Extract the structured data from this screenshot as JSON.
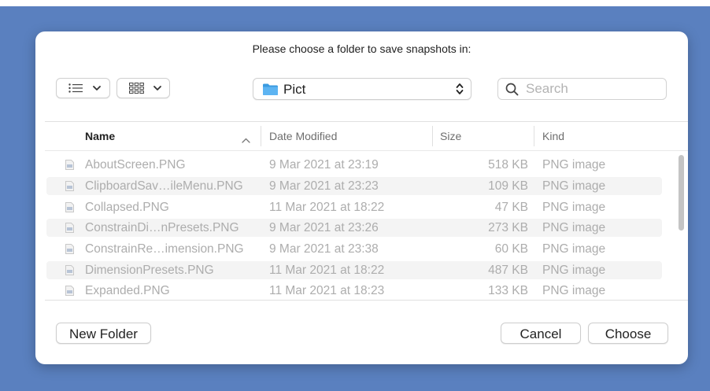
{
  "dialog": {
    "prompt": "Please choose a folder to save snapshots in:"
  },
  "toolbar": {
    "list_view_icon": "list-view-icon",
    "grid_view_icon": "grid-view-icon",
    "folder": {
      "icon": "folder-icon",
      "name": "Pict"
    },
    "search": {
      "placeholder": "Search",
      "value": ""
    }
  },
  "table": {
    "columns": [
      "Name",
      "Date Modified",
      "Size",
      "Kind"
    ],
    "sorted_by": "Name",
    "rows": [
      {
        "name": "AboutScreen.PNG",
        "date": "9 Mar 2021 at 23:19",
        "size": "518 KB",
        "kind": "PNG image"
      },
      {
        "name": "ClipboardSav…ileMenu.PNG",
        "date": "9 Mar 2021 at 23:23",
        "size": "109 KB",
        "kind": "PNG image"
      },
      {
        "name": "Collapsed.PNG",
        "date": "11 Mar 2021 at 18:22",
        "size": "47 KB",
        "kind": "PNG image"
      },
      {
        "name": "ConstrainDi…nPresets.PNG",
        "date": "9 Mar 2021 at 23:26",
        "size": "273 KB",
        "kind": "PNG image"
      },
      {
        "name": "ConstrainRe…imension.PNG",
        "date": "9 Mar 2021 at 23:38",
        "size": "60 KB",
        "kind": "PNG image"
      },
      {
        "name": "DimensionPresets.PNG",
        "date": "11 Mar 2021 at 18:22",
        "size": "487 KB",
        "kind": "PNG image"
      },
      {
        "name": "Expanded.PNG",
        "date": "11 Mar 2021 at 18:23",
        "size": "133 KB",
        "kind": "PNG image"
      }
    ]
  },
  "buttons": {
    "new_folder": "New Folder",
    "cancel": "Cancel",
    "choose": "Choose"
  },
  "colors": {
    "desktop": "#5a80bf",
    "folder_blue": "#4aa6e8",
    "dimmed_text": "#adadad"
  }
}
